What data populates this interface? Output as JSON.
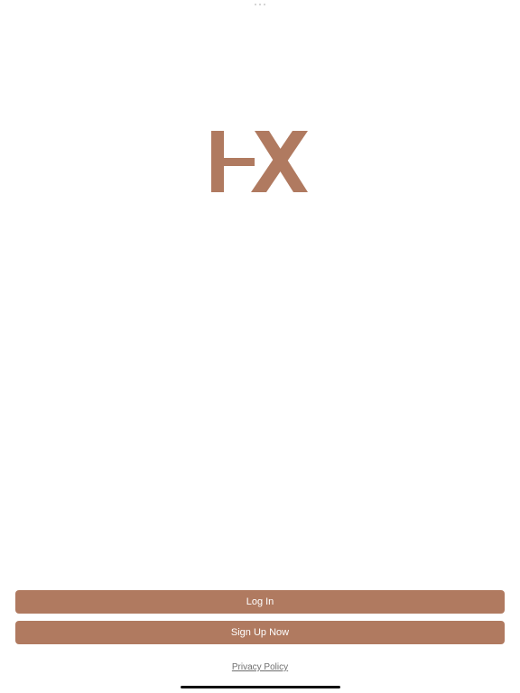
{
  "colors": {
    "brand": "#b07a60",
    "background": "#ffffff",
    "home_indicator": "#111111"
  },
  "logo": {
    "icon": "hx-logo-icon"
  },
  "actions": {
    "login_label": "Log In",
    "signup_label": "Sign Up Now"
  },
  "footer": {
    "privacy_label": "Privacy Policy"
  }
}
